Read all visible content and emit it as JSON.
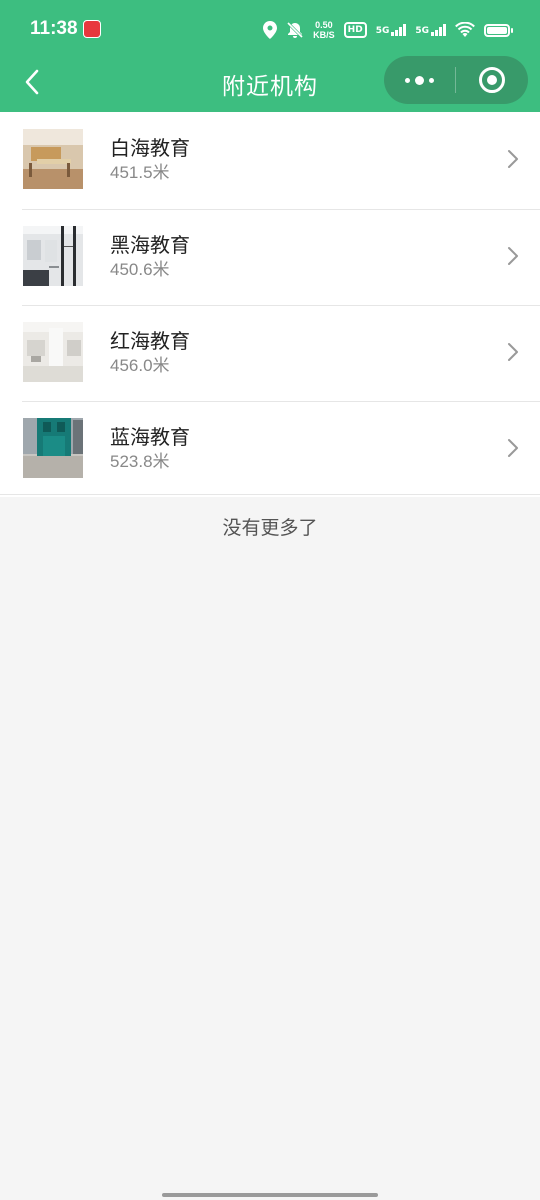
{
  "status_bar": {
    "time": "11:38",
    "speed_value": "0.50",
    "speed_unit": "KB/S",
    "hd_label": "HD",
    "net1_label": "5G",
    "net2_label": "5G",
    "icons": [
      "location-icon",
      "mute-icon",
      "wifi-icon",
      "battery-icon"
    ]
  },
  "navbar": {
    "title": "附近机构",
    "back_icon": "chevron-left-icon",
    "more_icon": "more-dots-icon",
    "close_icon": "target-icon"
  },
  "institutions": [
    {
      "name": "白海教育",
      "distance": "451.5米"
    },
    {
      "name": "黑海教育",
      "distance": "450.6米"
    },
    {
      "name": "红海教育",
      "distance": "456.0米"
    },
    {
      "name": "蓝海教育",
      "distance": "523.8米"
    }
  ],
  "footer": {
    "no_more_text": "没有更多了"
  },
  "colors": {
    "brand_green": "#3dbe80",
    "capsule_green": "#389a6a",
    "background": "#f5f5f5"
  }
}
